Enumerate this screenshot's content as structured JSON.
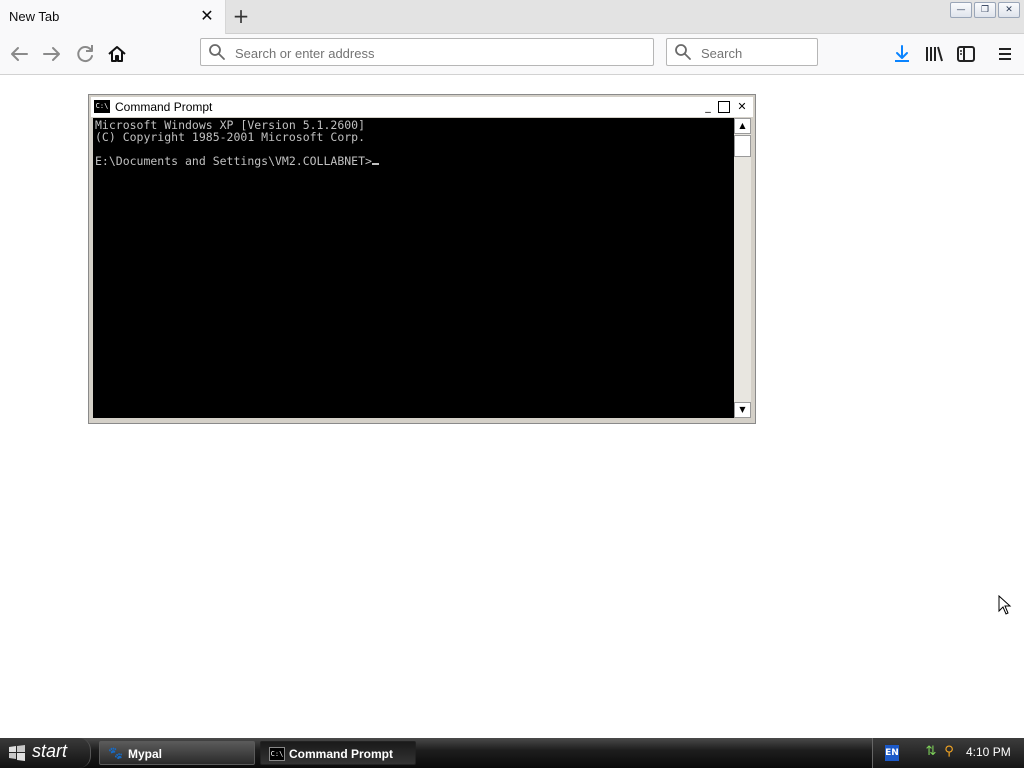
{
  "browser": {
    "tab_title": "New Tab",
    "url_placeholder": "Search or enter address",
    "search_placeholder": "Search",
    "accent_color": "#0a84ff"
  },
  "cmd": {
    "title": "Command Prompt",
    "icon_text": "C:\\",
    "lines": [
      "Microsoft Windows XP [Version 5.1.2600]",
      "(C) Copyright 1985-2001 Microsoft Corp.",
      "",
      "E:\\Documents and Settings\\VM2.COLLABNET>"
    ],
    "text_color": "#c0c0c0",
    "background": "#000000"
  },
  "taskbar": {
    "start_label": "start",
    "tasks": [
      {
        "label": "Mypal",
        "icon": "mypal-icon"
      },
      {
        "label": "Command Prompt",
        "icon": "cmd-icon"
      }
    ],
    "tray": {
      "lang": "EN",
      "time": "4:10 PM"
    }
  }
}
